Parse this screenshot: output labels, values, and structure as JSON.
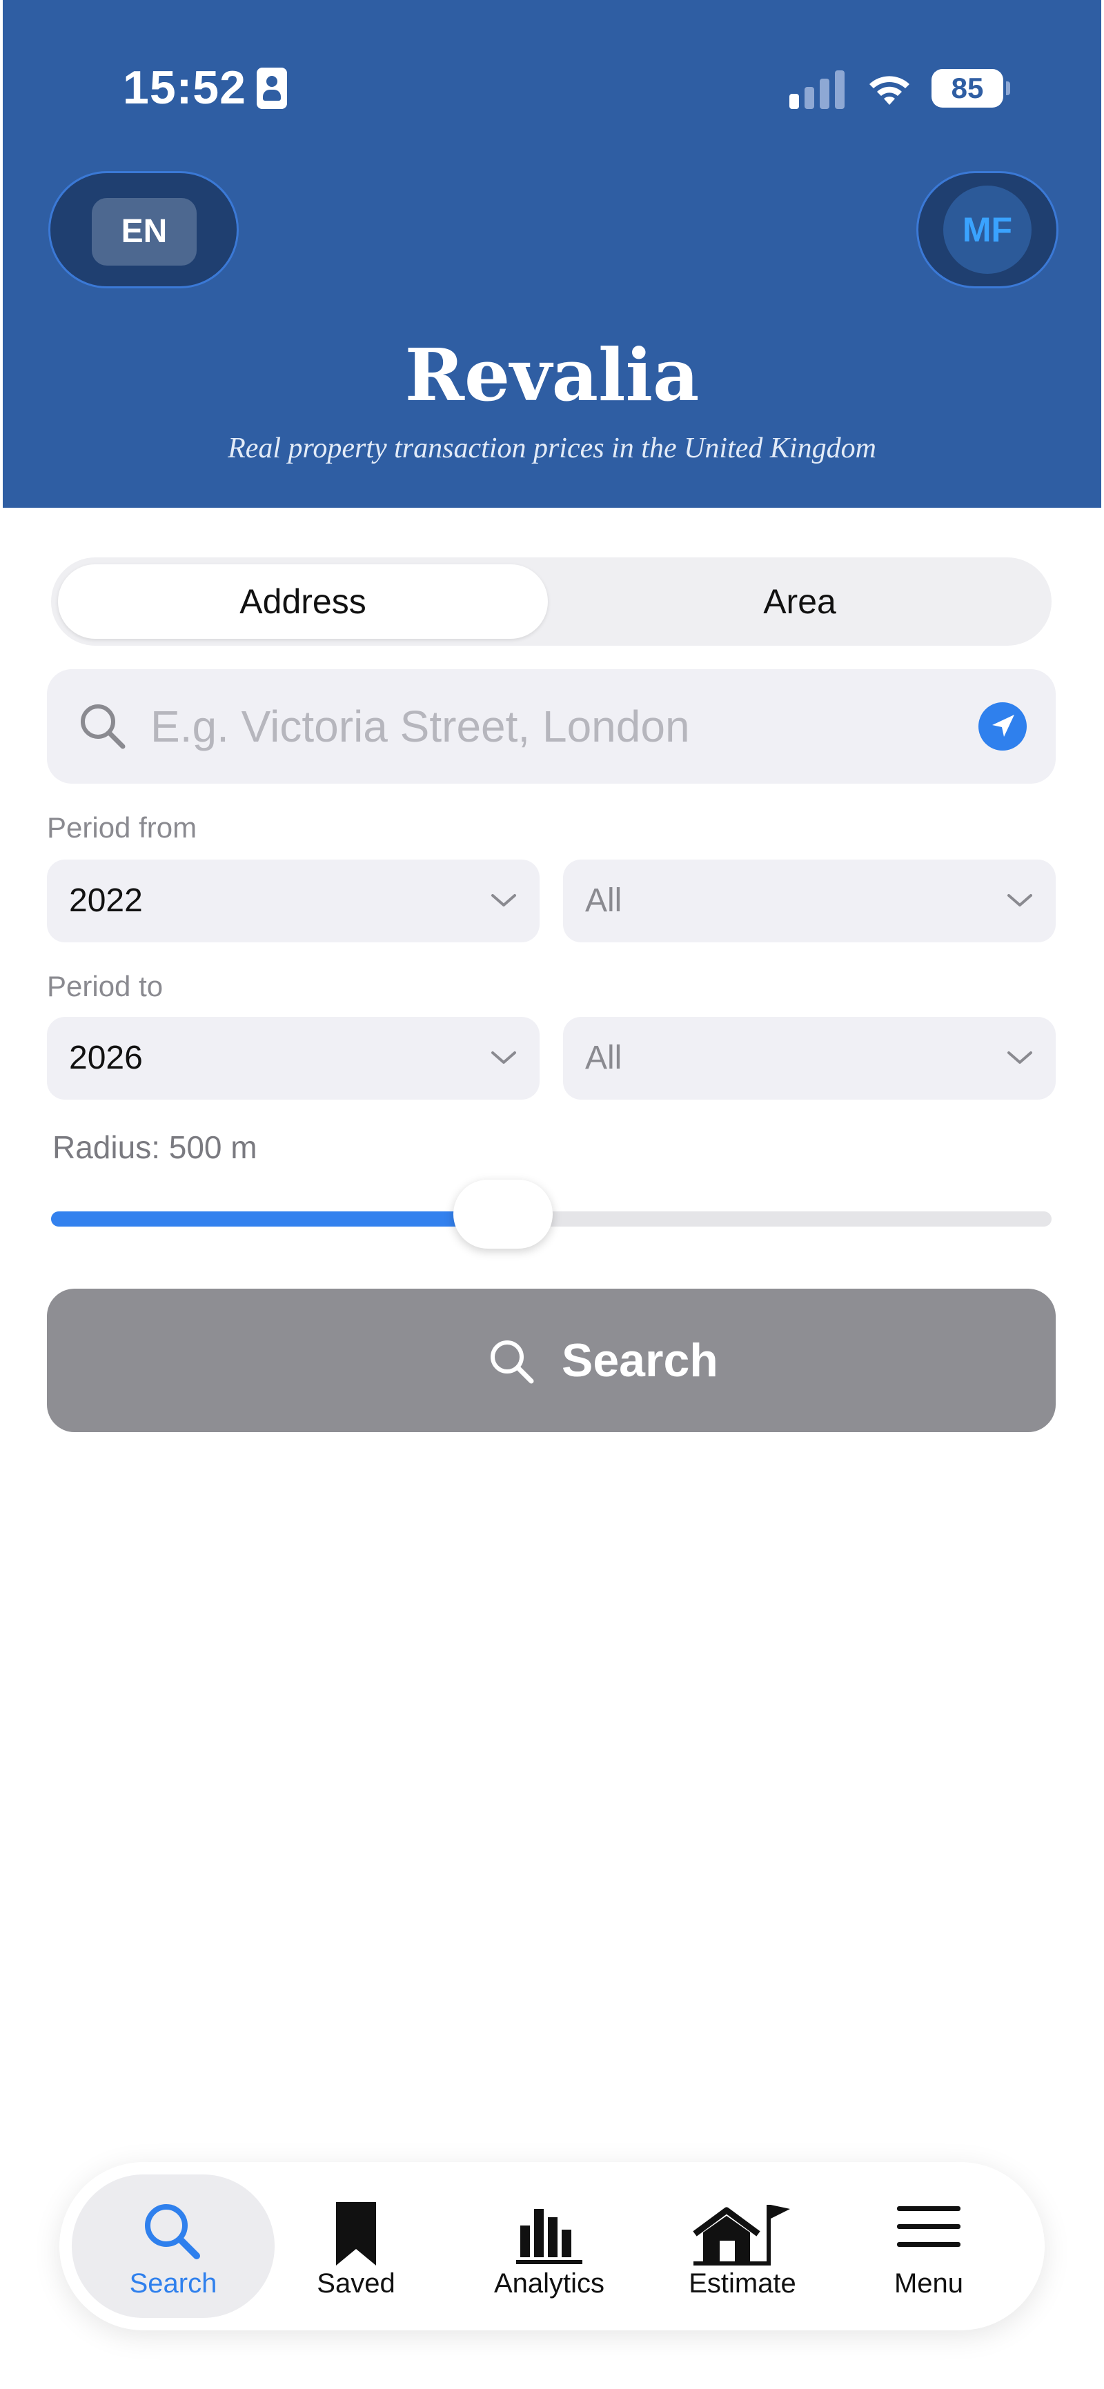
{
  "status_bar": {
    "time": "15:52",
    "battery": "85"
  },
  "header": {
    "language": "EN",
    "avatar_initials": "MF",
    "title": "Revalia",
    "subtitle": "Real property transaction prices in the United Kingdom",
    "background_color": "#2f5ea3"
  },
  "mode_switch": {
    "options": [
      "Address",
      "Area"
    ],
    "selected": "Address"
  },
  "search": {
    "placeholder": "E.g. Victoria Street, London",
    "value": "",
    "icon": "search-icon",
    "location_icon": "location-arrow-icon"
  },
  "period_from": {
    "label": "Period from",
    "year": "2022",
    "month": "All"
  },
  "period_to": {
    "label": "Period to",
    "year": "2026",
    "month": "All"
  },
  "radius": {
    "label": "Radius: 500 m",
    "fraction": 0.45
  },
  "search_button": {
    "label": "Search",
    "color": "#8e8e93"
  },
  "tabbar": {
    "items": [
      {
        "label": "Search",
        "icon": "search-icon",
        "active": true
      },
      {
        "label": "Saved",
        "icon": "bookmark-icon",
        "active": false
      },
      {
        "label": "Analytics",
        "icon": "bar-chart-icon",
        "active": false
      },
      {
        "label": "Estimate",
        "icon": "house-flag-icon",
        "active": false
      },
      {
        "label": "Menu",
        "icon": "hamburger-menu-icon",
        "active": false
      }
    ],
    "accent_color": "#2f80ed"
  }
}
